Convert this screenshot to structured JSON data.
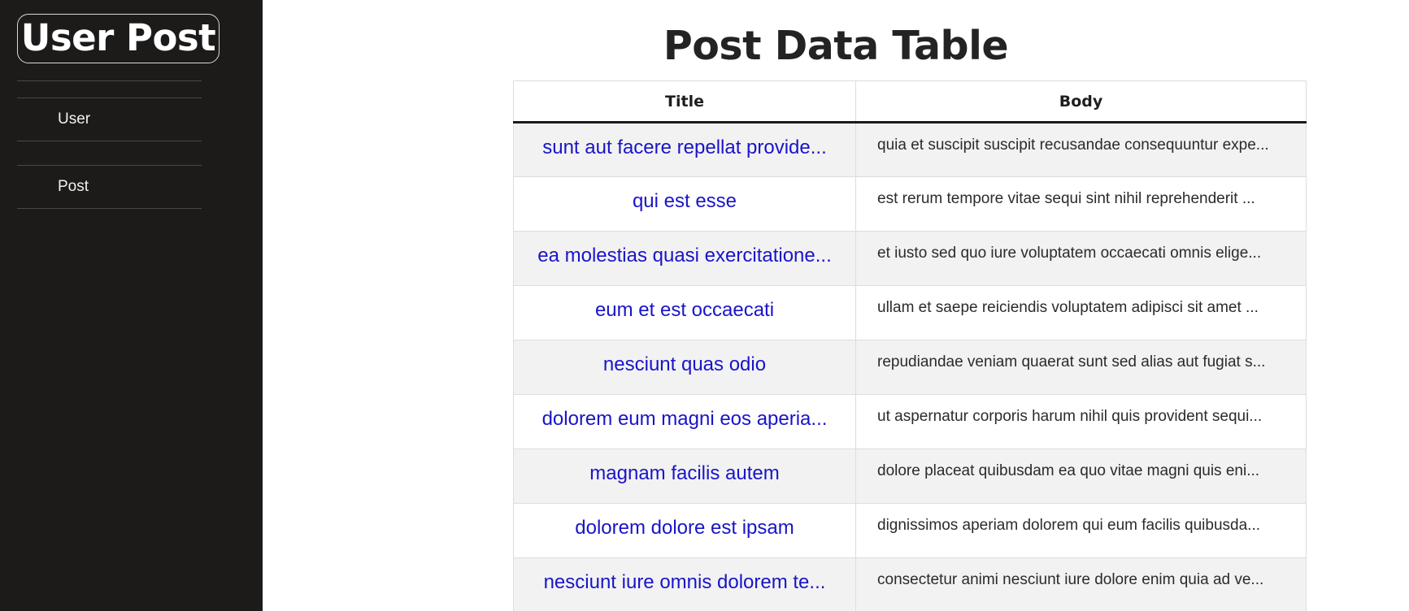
{
  "brand": {
    "title": "User Post"
  },
  "nav": {
    "items": [
      {
        "label": "User"
      },
      {
        "label": "Post"
      }
    ]
  },
  "main": {
    "title": "Post Data Table",
    "table": {
      "headers": [
        "Title",
        "Body"
      ],
      "rows": [
        {
          "title": "sunt aut facere repellat provide...",
          "body": "quia et suscipit suscipit recusandae consequuntur expe..."
        },
        {
          "title": "qui est esse",
          "body": "est rerum tempore vitae sequi sint nihil reprehenderit ..."
        },
        {
          "title": "ea molestias quasi exercitatione...",
          "body": "et iusto sed quo iure voluptatem occaecati omnis elige..."
        },
        {
          "title": "eum et est occaecati",
          "body": "ullam et saepe reiciendis voluptatem adipisci sit amet ..."
        },
        {
          "title": "nesciunt quas odio",
          "body": "repudiandae veniam quaerat sunt sed alias aut fugiat s..."
        },
        {
          "title": "dolorem eum magni eos aperia...",
          "body": "ut aspernatur corporis harum nihil quis provident sequi..."
        },
        {
          "title": "magnam facilis autem",
          "body": "dolore placeat quibusdam ea quo vitae magni quis eni..."
        },
        {
          "title": "dolorem dolore est ipsam",
          "body": "dignissimos aperiam dolorem qui eum facilis quibusda..."
        },
        {
          "title": "nesciunt iure omnis dolorem te...",
          "body": "consectetur animi nesciunt iure dolore enim quia ad ve..."
        }
      ]
    }
  },
  "colors": {
    "sidebar_bg": "#1d1b1a",
    "link": "#1a14c8",
    "row_alt": "#f2f2f2"
  }
}
